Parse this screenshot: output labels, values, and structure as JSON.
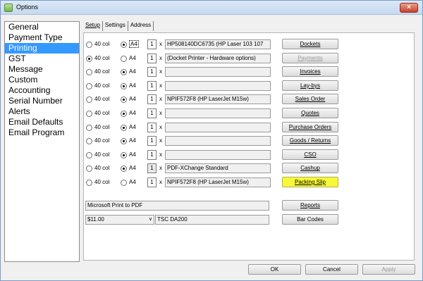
{
  "window": {
    "title": "Options",
    "close_glyph": "×"
  },
  "sidebar": {
    "items": [
      {
        "label": "General",
        "selected": false
      },
      {
        "label": "Payment Type",
        "selected": false
      },
      {
        "label": "Printing",
        "selected": true
      },
      {
        "label": "GST",
        "selected": false
      },
      {
        "label": "Message",
        "selected": false
      },
      {
        "label": "Custom",
        "selected": false
      },
      {
        "label": "Accounting",
        "selected": false
      },
      {
        "label": "Serial Number",
        "selected": false
      },
      {
        "label": "Alerts",
        "selected": false
      },
      {
        "label": "Email Defaults",
        "selected": false
      },
      {
        "label": "Email Program",
        "selected": false
      }
    ]
  },
  "tabs": [
    {
      "label": "Setup",
      "active": true
    },
    {
      "label": "Settings",
      "active": false
    },
    {
      "label": "Address",
      "active": false
    }
  ],
  "printing": {
    "col_label": "40 col",
    "a4_label": "A4",
    "times": "x",
    "rows": [
      {
        "selected": "A4",
        "qty": "1",
        "printer": "HP508140DC6735 (HP Laser 103 107",
        "button": "Dockets",
        "button_state": "normal",
        "qty_disabled": false
      },
      {
        "selected": "40col",
        "qty": "1",
        "printer": "(Docket Printer - Hardware options)",
        "button": "Payments",
        "button_state": "disabled",
        "qty_disabled": false
      },
      {
        "selected": "A4",
        "qty": "1",
        "printer": "",
        "button": "Invoices",
        "button_state": "normal",
        "qty_disabled": false
      },
      {
        "selected": "A4",
        "qty": "1",
        "printer": "",
        "button": "Lay-bys",
        "button_state": "normal",
        "qty_disabled": false
      },
      {
        "selected": "A4",
        "qty": "1",
        "printer": "NPIF572F8 (HP LaserJet M15w)",
        "button": "Sales Order",
        "button_state": "normal",
        "qty_disabled": false
      },
      {
        "selected": "A4",
        "qty": "1",
        "printer": "",
        "button": "Quotes",
        "button_state": "normal",
        "qty_disabled": false
      },
      {
        "selected": "A4",
        "qty": "1",
        "printer": "",
        "button": "Purchase Orders",
        "button_state": "normal",
        "qty_disabled": false
      },
      {
        "selected": "A4",
        "qty": "1",
        "printer": "",
        "button": "Goods / Returns",
        "button_state": "normal",
        "qty_disabled": false
      },
      {
        "selected": "A4",
        "qty": "1",
        "printer": "",
        "button": "CSO",
        "button_state": "normal",
        "qty_disabled": false
      },
      {
        "selected": "A4",
        "qty": "1",
        "printer": "PDF-XChange Standard",
        "button": "Cashup",
        "button_state": "normal",
        "qty_disabled": true
      },
      {
        "selected": "none",
        "qty": "1",
        "printer": "NPIF572F8 (HP LaserJet M15w)",
        "button": "Packing Slip",
        "button_state": "highlight",
        "qty_disabled": false
      }
    ],
    "reports_printer": "Microsoft Print to PDF",
    "reports_button": "Reports",
    "barcode_price": "$11.00",
    "barcode_printer": "TSC DA200",
    "barcode_button": "Bar Codes"
  },
  "footer": {
    "ok": "OK",
    "cancel": "Cancel",
    "apply": "Apply"
  },
  "colors": {
    "selection": "#3399ff",
    "highlight": "#f8f83a"
  }
}
